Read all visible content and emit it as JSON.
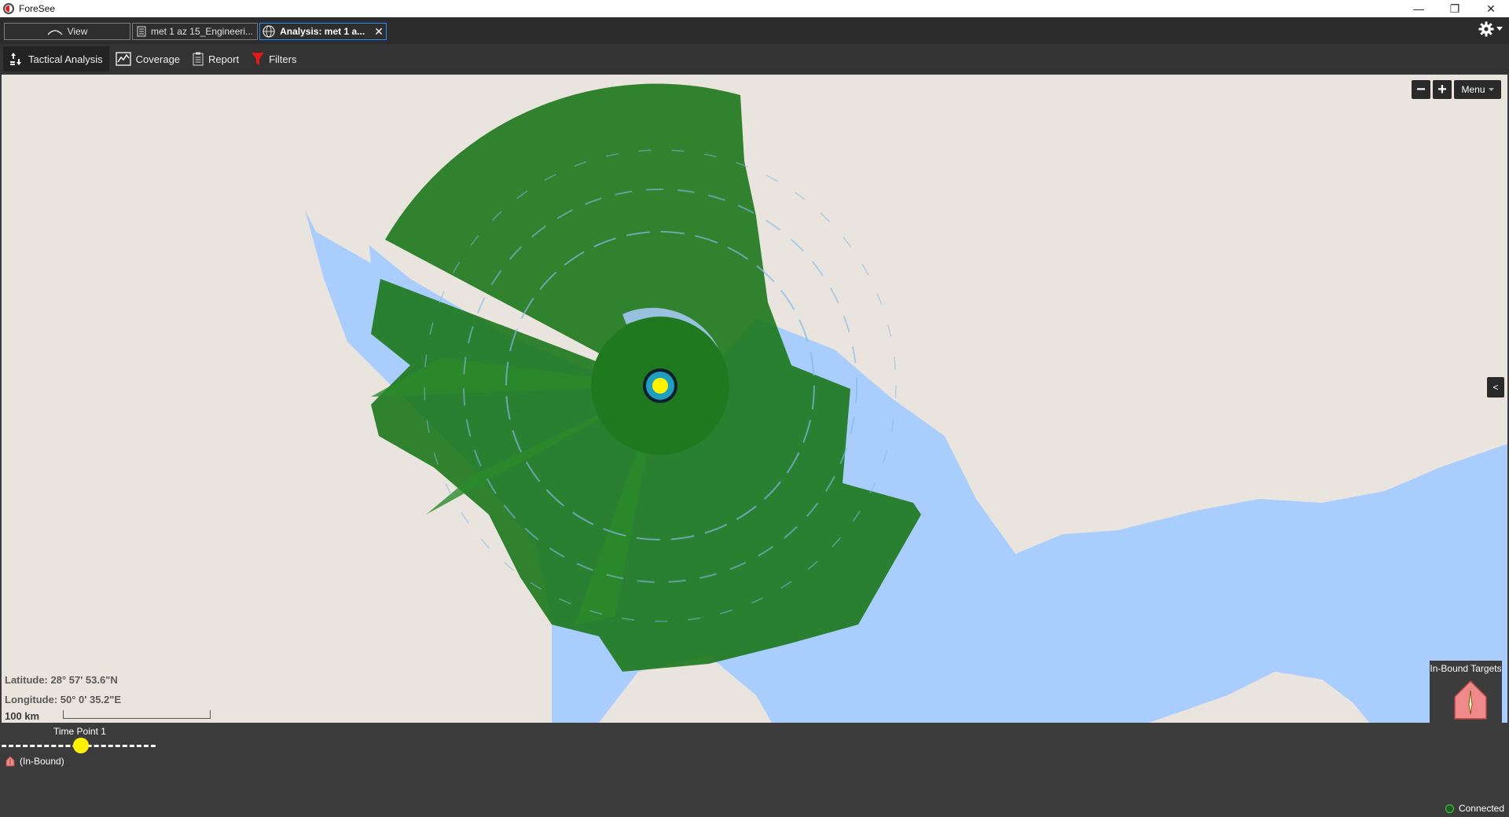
{
  "window": {
    "title": "ForeSee",
    "minimize": "—",
    "restore": "❐",
    "close": "✕"
  },
  "tabs": [
    {
      "label": "View",
      "icon": "view-arc-icon"
    },
    {
      "label": "met 1 az 15_Engineeri...",
      "icon": "document-icon"
    },
    {
      "label": "Analysis: met 1 a...",
      "icon": "globe-icon",
      "close": "✕"
    }
  ],
  "toolbar": {
    "tactical": "Tactical Analysis",
    "coverage": "Coverage",
    "report": "Report",
    "filters": "Filters"
  },
  "map": {
    "zoom_out": "−",
    "zoom_in": "+",
    "menu": "Menu",
    "side_toggle": "<",
    "latitude": "Latitude: 28° 57'  53.6\"N",
    "longitude": "Longitude: 50° 0'  35.2\"E",
    "scale": "100 km",
    "inbound_targets": "In-Bound Targets"
  },
  "timeline": {
    "time_point": "Time Point 1",
    "legend": "(In-Bound)",
    "status": "Connected"
  },
  "colors": {
    "land": "#e9e5de",
    "water": "#a9cdfd",
    "coverage": "#1f7a1f",
    "active_tab_border": "#1e90ff",
    "marker": "#fff200",
    "target_marker": "#f08a8a"
  }
}
